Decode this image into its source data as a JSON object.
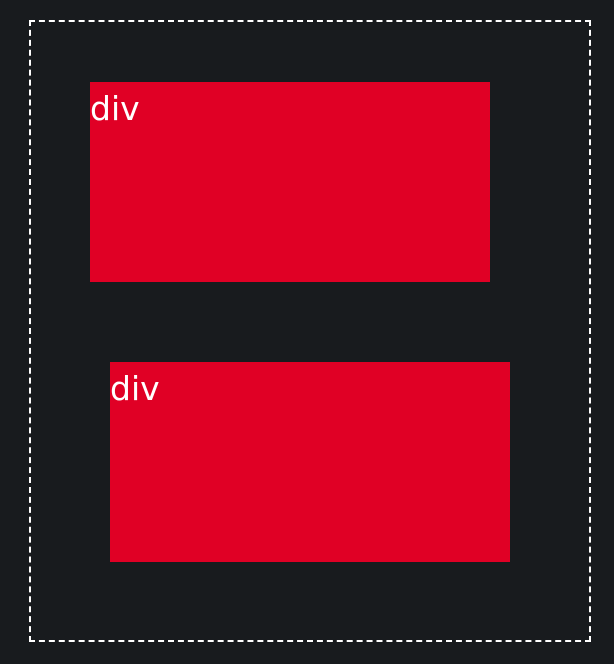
{
  "colors": {
    "background": "#181b1e",
    "box_fill": "#e00025",
    "label_text": "#ffffff",
    "dashed_border": "#ffffff"
  },
  "boxes": [
    {
      "label": "div"
    },
    {
      "label": "div"
    }
  ]
}
